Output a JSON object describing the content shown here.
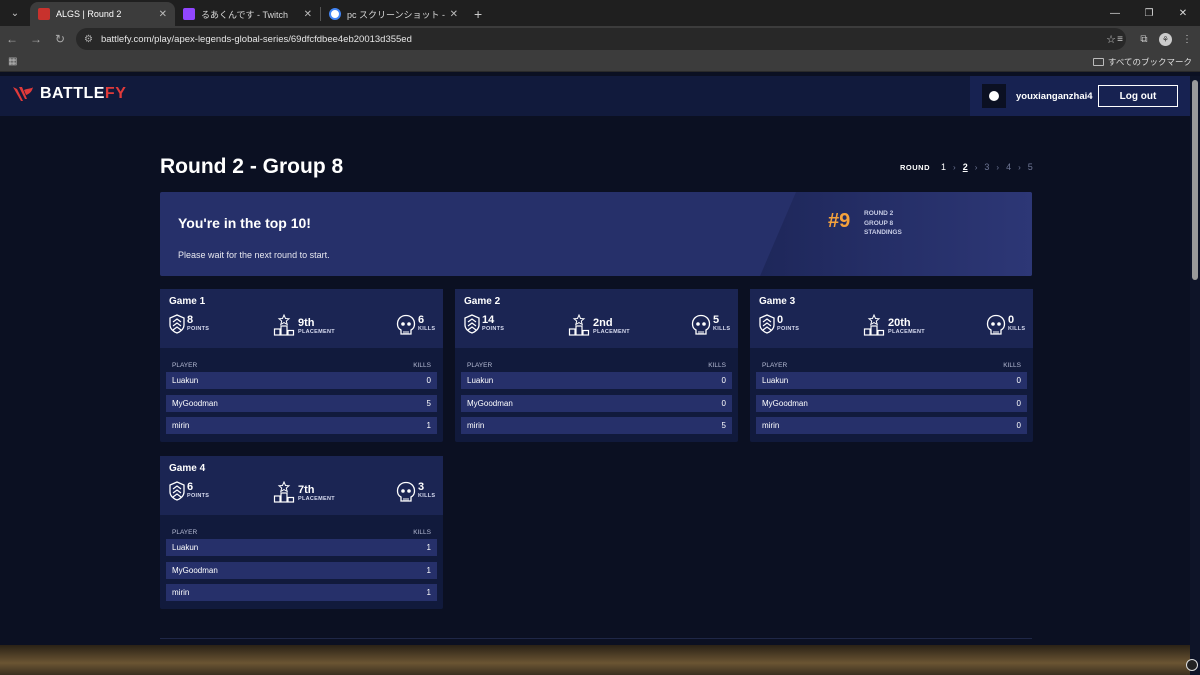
{
  "browser": {
    "tabs": [
      {
        "title": "ALGS | Round 2",
        "active": true,
        "favicon_color": "#c8322d"
      },
      {
        "title": "るあくんです - Twitch",
        "active": false,
        "favicon_color": "#9146ff"
      },
      {
        "title": "pc スクリーンショット - Google 検索",
        "active": false,
        "favicon_color": "#4285f4"
      }
    ],
    "url": "battlefy.com/play/apex-legends-global-series/69dfcfdbee4eb20013d355ed",
    "bookmarks_all": "すべてのブックマーク"
  },
  "site": {
    "logo_main": "BATTLE",
    "logo_accent": "FY",
    "username": "youxianganzhai4",
    "logout_label": "Log out"
  },
  "page": {
    "title": "Round 2 - Group 8",
    "round_nav": {
      "label": "ROUND",
      "rounds": [
        "1",
        "2",
        "3",
        "4",
        "5"
      ],
      "current": "2"
    }
  },
  "banner": {
    "heading": "You're in the top 10!",
    "subtext": "Please wait for the next round to start.",
    "rank": "#9",
    "meta_line1": "ROUND 2",
    "meta_line2": "GROUP 8",
    "meta_line3": "STANDINGS"
  },
  "labels": {
    "points": "POINTS",
    "placement": "PLACEMENT",
    "kills": "KILLS",
    "col_player": "PLAYER",
    "col_kills": "KILLS"
  },
  "games": [
    {
      "title": "Game 1",
      "points": "8",
      "placement": "9th",
      "kills": "6",
      "players": [
        {
          "name": "Luakun",
          "kills": "0"
        },
        {
          "name": "MyGoodman",
          "kills": "5"
        },
        {
          "name": "mirin",
          "kills": "1"
        }
      ]
    },
    {
      "title": "Game 2",
      "points": "14",
      "placement": "2nd",
      "kills": "5",
      "players": [
        {
          "name": "Luakun",
          "kills": "0"
        },
        {
          "name": "MyGoodman",
          "kills": "0"
        },
        {
          "name": "mirin",
          "kills": "5"
        }
      ]
    },
    {
      "title": "Game 3",
      "points": "0",
      "placement": "20th",
      "kills": "0",
      "players": [
        {
          "name": "Luakun",
          "kills": "0"
        },
        {
          "name": "MyGoodman",
          "kills": "0"
        },
        {
          "name": "mirin",
          "kills": "0"
        }
      ]
    },
    {
      "title": "Game 4",
      "points": "6",
      "placement": "7th",
      "kills": "3",
      "players": [
        {
          "name": "Luakun",
          "kills": "1"
        },
        {
          "name": "MyGoodman",
          "kills": "1"
        },
        {
          "name": "mirin",
          "kills": "1"
        }
      ]
    }
  ],
  "colors": {
    "brand_red": "#e03a3a",
    "rank_orange": "#f5a23c",
    "page_bg": "#0b1022",
    "card_bg": "#111a3c",
    "row_bg": "#26306a"
  }
}
